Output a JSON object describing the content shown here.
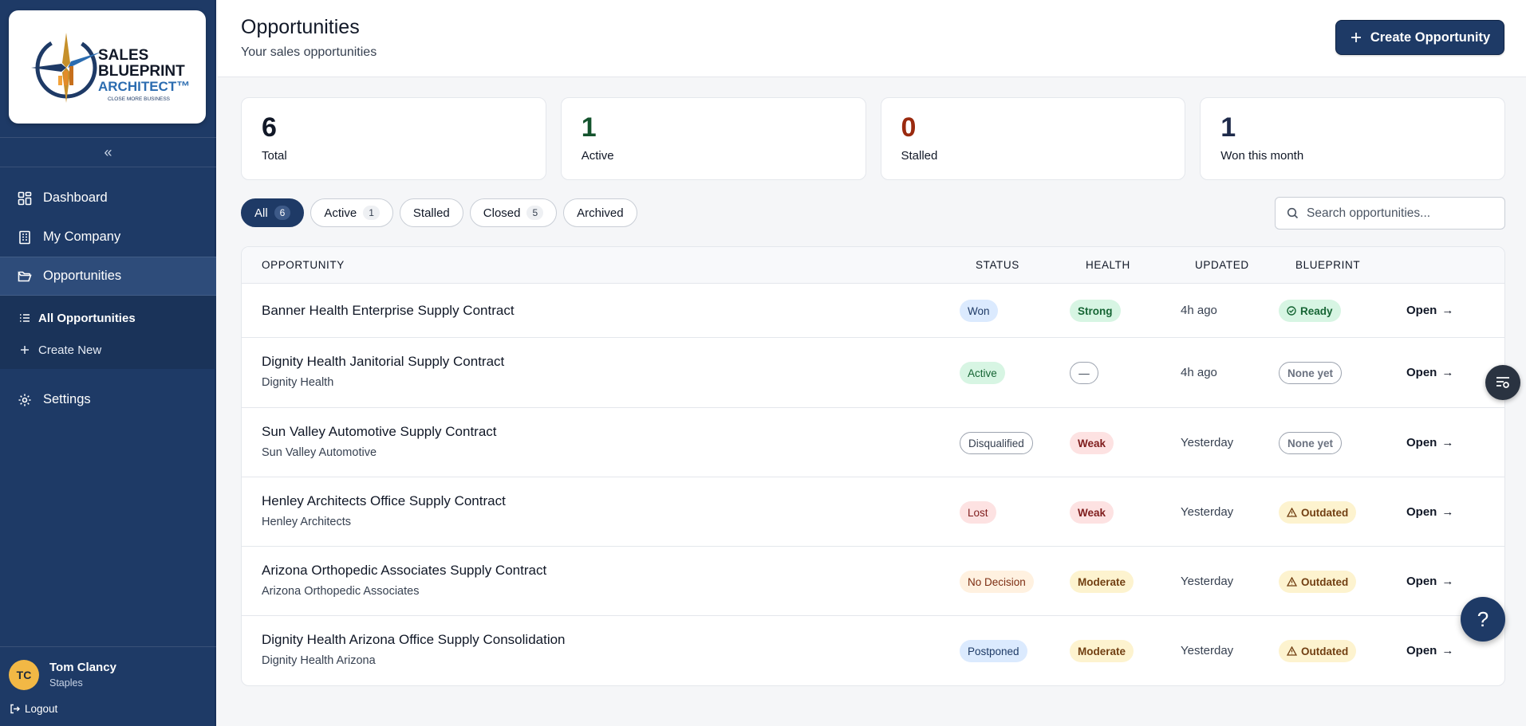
{
  "brand": {
    "line1": "SALES",
    "line2": "BLUEPRINT",
    "line3": "ARCHITECT™",
    "tagline": "CLOSE MORE BUSINESS"
  },
  "sidebar": {
    "collapse_glyph": "«",
    "items": [
      {
        "label": "Dashboard",
        "icon": "dashboard-grid-icon"
      },
      {
        "label": "My Company",
        "icon": "building-icon"
      },
      {
        "label": "Opportunities",
        "icon": "folder-open-icon",
        "active": true
      }
    ],
    "sub_items": [
      {
        "label": "All Opportunities",
        "icon": "list-icon",
        "current": true
      },
      {
        "label": "Create New",
        "icon": "plus-icon"
      }
    ],
    "settings_label": "Settings"
  },
  "user": {
    "initials": "TC",
    "name": "Tom Clancy",
    "company": "Staples",
    "logout_label": "Logout"
  },
  "header": {
    "title": "Opportunities",
    "subtitle": "Your sales opportunities",
    "create_label": "Create Opportunity"
  },
  "stats": [
    {
      "value": "6",
      "label": "Total",
      "color": "#111827"
    },
    {
      "value": "1",
      "label": "Active",
      "color": "#14532d"
    },
    {
      "value": "0",
      "label": "Stalled",
      "color": "#9a2a0f"
    },
    {
      "value": "1",
      "label": "Won this month",
      "color": "#1e2a4a"
    }
  ],
  "filters": [
    {
      "label": "All",
      "count": "6",
      "active": true
    },
    {
      "label": "Active",
      "count": "1"
    },
    {
      "label": "Stalled",
      "count": null
    },
    {
      "label": "Closed",
      "count": "5"
    },
    {
      "label": "Archived",
      "count": null
    }
  ],
  "search": {
    "placeholder": "Search opportunities..."
  },
  "table": {
    "headers": {
      "opportunity": "OPPORTUNITY",
      "status": "STATUS",
      "health": "HEALTH",
      "updated": "UPDATED",
      "blueprint": "BLUEPRINT"
    },
    "open_label": "Open",
    "rows": [
      {
        "name": "Banner Health Enterprise Supply Contract",
        "company": "",
        "status": "Won",
        "health": "Strong",
        "updated": "4h ago",
        "blueprint": "Ready"
      },
      {
        "name": "Dignity Health Janitorial Supply Contract",
        "company": "Dignity Health",
        "status": "Active",
        "health": "—",
        "updated": "4h ago",
        "blueprint": "None yet"
      },
      {
        "name": "Sun Valley Automotive Supply Contract",
        "company": "Sun Valley Automotive",
        "status": "Disqualified",
        "health": "Weak",
        "updated": "Yesterday",
        "blueprint": "None yet"
      },
      {
        "name": "Henley Architects Office Supply Contract",
        "company": "Henley Architects",
        "status": "Lost",
        "health": "Weak",
        "updated": "Yesterday",
        "blueprint": "Outdated"
      },
      {
        "name": "Arizona Orthopedic Associates Supply Contract",
        "company": "Arizona Orthopedic Associates",
        "status": "No Decision",
        "health": "Moderate",
        "updated": "Yesterday",
        "blueprint": "Outdated"
      },
      {
        "name": "Dignity Health Arizona Office Supply Consolidation",
        "company": "Dignity Health Arizona",
        "status": "Postponed",
        "health": "Moderate",
        "updated": "Yesterday",
        "blueprint": "Outdated"
      }
    ]
  },
  "help_glyph": "?"
}
